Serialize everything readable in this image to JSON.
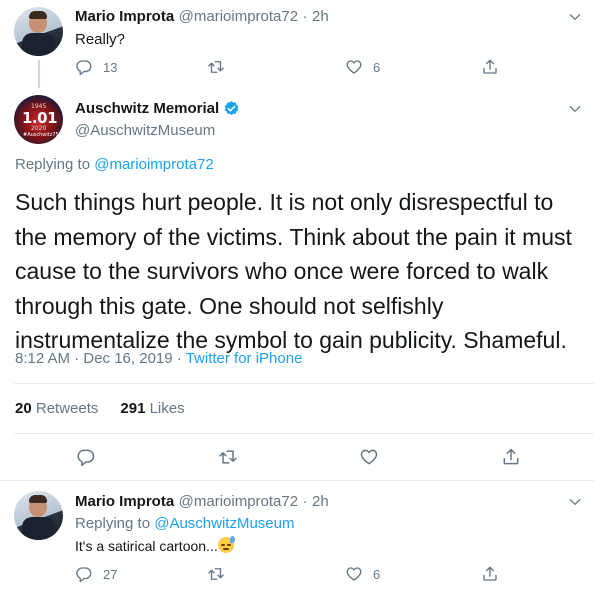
{
  "tweet1": {
    "name": "Mario Improta",
    "handle": "@marioimprota72",
    "separator": "·",
    "time": "2h",
    "text": "Really?",
    "replies": "13",
    "retweets": "",
    "likes": "6"
  },
  "tweet2": {
    "name": "Auschwitz Memorial",
    "handle": "@AuschwitzMuseum",
    "verified": true,
    "avatar": {
      "year_top": "1945",
      "day": "1.01",
      "year_bottom": "2020",
      "tag": "#Auschwitz75"
    },
    "replying_to_label": "Replying to",
    "replying_to_handle": "@marioimprota72",
    "text_lines": [
      "Such things hurt people. It is not only disrespectful to",
      "the memory of the victims. Think about the pain it must",
      "cause to the survivors who once were forced to walk",
      "through this gate. One should not selfishly",
      "instrumentalize the symbol to gain publicity. Shameful."
    ],
    "timestamp": "8:12 AM · Dec 16, 2019",
    "source_separator": "·",
    "source": "Twitter for iPhone",
    "retweets_count": "20",
    "retweets_label": "Retweets",
    "likes_count": "291",
    "likes_label": "Likes"
  },
  "tweet3": {
    "name": "Mario Improta",
    "handle": "@marioimprota72",
    "separator": "·",
    "time": "2h",
    "replying_to_label": "Replying to",
    "replying_to_handle": "@AuschwitzMuseum",
    "text": "It's a satirical cartoon...",
    "replies": "27",
    "retweets": "",
    "likes": "6"
  },
  "colors": {
    "accent": "#1da1f2",
    "secondary_text": "#657786",
    "primary_text": "#14171a",
    "divider": "#e6ecf0"
  },
  "icons": [
    "reply-icon",
    "retweet-icon",
    "like-icon",
    "share-icon",
    "chevron-down-icon",
    "verified-badge-icon"
  ]
}
